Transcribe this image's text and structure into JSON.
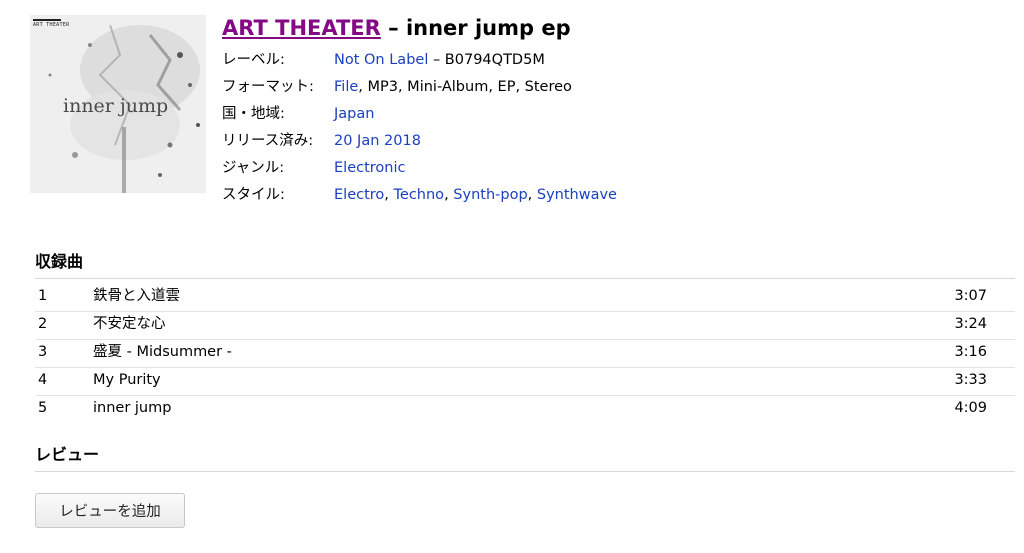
{
  "cover": {
    "brand_text": "ART THEATER",
    "title_text": "inner jump"
  },
  "release": {
    "artist": "ART THEATER",
    "separator": " – ",
    "title": "inner jump ep"
  },
  "meta": {
    "label": {
      "key": "レーベル:",
      "link": "Not On Label",
      "suffix": " – B0794QTD5M"
    },
    "format": {
      "key": "フォーマット:",
      "link": "File",
      "suffix": ", MP3, Mini-Album, EP, Stereo"
    },
    "country": {
      "key": "国・地域:",
      "link": "Japan"
    },
    "released": {
      "key": "リリース済み:",
      "link": "20 Jan 2018"
    },
    "genre": {
      "key": "ジャンル:",
      "link": "Electronic"
    },
    "style": {
      "key": "スタイル:",
      "links": [
        "Electro",
        "Techno",
        "Synth-pop",
        "Synthwave"
      ],
      "sep": ", "
    }
  },
  "tracklist": {
    "heading": "収録曲",
    "tracks": [
      {
        "pos": "1",
        "title": "鉄骨と入道雲",
        "duration": "3:07"
      },
      {
        "pos": "2",
        "title": "不安定な心",
        "duration": "3:24"
      },
      {
        "pos": "3",
        "title": "盛夏 - Midsummer -",
        "duration": "3:16"
      },
      {
        "pos": "4",
        "title": "My Purity",
        "duration": "3:33"
      },
      {
        "pos": "5",
        "title": "inner jump",
        "duration": "4:09"
      }
    ]
  },
  "reviews": {
    "heading": "レビュー",
    "add_button": "レビューを追加"
  },
  "colors": {
    "artist": "#840985",
    "link": "#1a3fbf"
  }
}
